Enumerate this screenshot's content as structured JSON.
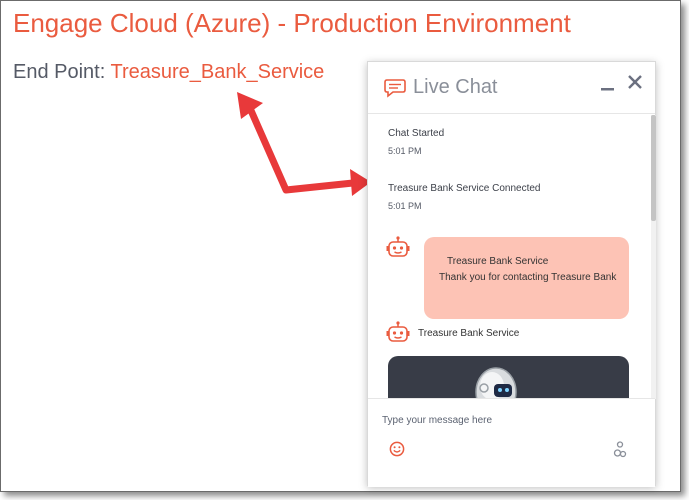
{
  "page": {
    "title": "Engage Cloud (Azure) - Production Environment",
    "endpoint_label": "End Point: ",
    "endpoint_value": "Treasure_Bank_Service"
  },
  "chat": {
    "title": "Live Chat",
    "messages": [
      {
        "text": "Chat Started",
        "time": "5:01 PM"
      },
      {
        "text": "Treasure Bank Service Connected",
        "time": "5:01 PM"
      }
    ],
    "bubble": {
      "sender": "Treasure Bank Service",
      "text": "Thank you for contacting Treasure Bank"
    },
    "bot_name": "Treasure Bank Service",
    "input_placeholder": "Type your message here"
  },
  "icons": [
    "chat-bubble-icon",
    "minimize-icon",
    "close-icon",
    "bot-icon",
    "emoji-icon",
    "attachment-icon"
  ],
  "colors": {
    "accent": "#ea5b3f",
    "bubble": "#fdc3b5",
    "arrow": "#e8393a",
    "media_card": "#383c47"
  }
}
